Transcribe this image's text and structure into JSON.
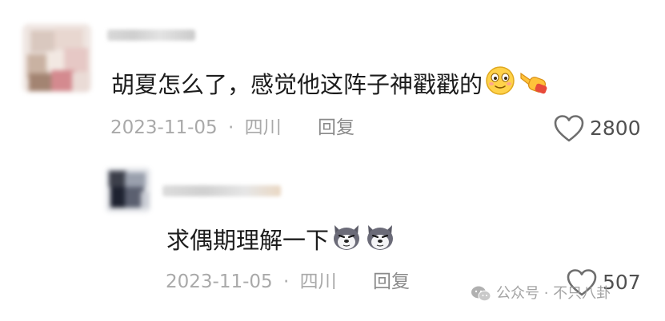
{
  "comment": {
    "text": "胡夏怎么了，感觉他这阵子神戳戳的",
    "emojis": [
      "smiling-face-emoji",
      "pointing-hand-emoji"
    ],
    "date": "2023-11-05",
    "separator": "·",
    "location": "四川",
    "reply_label": "回复",
    "likes": "2800"
  },
  "reply": {
    "text": "求偶期理解一下",
    "emojis": [
      "husky-dog-emoji",
      "husky-dog-emoji"
    ],
    "date": "2023-11-05",
    "separator": "·",
    "location": "四川",
    "reply_label": "回复",
    "likes": "507"
  },
  "watermark": {
    "icon": "wechat-icon",
    "text": "公众号 · 不只八卦"
  },
  "colors": {
    "text_primary": "#1c1c1c",
    "text_meta": "#a9a9a9",
    "reply_link": "#8a8a8a",
    "like_count": "#505050",
    "background": "#ffffff"
  }
}
